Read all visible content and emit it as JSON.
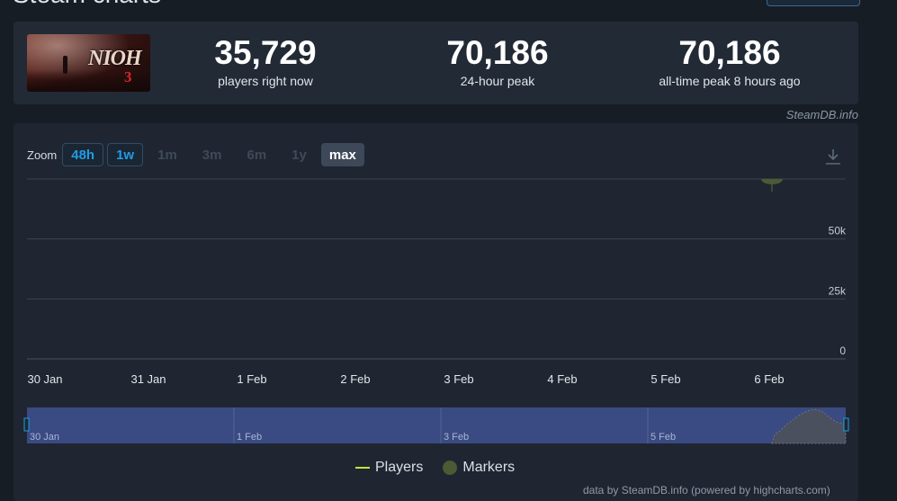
{
  "page": {
    "title": "Steam charts"
  },
  "stats": {
    "game": {
      "logo_text": "NIOH",
      "logo_number": "3"
    },
    "items": [
      {
        "value": "35,729",
        "label": "players right now"
      },
      {
        "value": "70,186",
        "label": "24-hour peak"
      },
      {
        "value": "70,186",
        "label": "all-time peak 8 hours ago"
      }
    ],
    "source": "SteamDB.info"
  },
  "chart": {
    "zoom_label": "Zoom",
    "zoom_options": [
      {
        "label": "48h",
        "state": "available"
      },
      {
        "label": "1w",
        "state": "available"
      },
      {
        "label": "1m",
        "state": "disabled"
      },
      {
        "label": "3m",
        "state": "disabled"
      },
      {
        "label": "6m",
        "state": "disabled"
      },
      {
        "label": "1y",
        "state": "disabled"
      },
      {
        "label": "max",
        "state": "selected"
      }
    ],
    "download_icon": "download-icon",
    "legend": {
      "players": "Players",
      "markers": "Markers"
    },
    "credit": "data by SteamDB.info (powered by highcharts.com)",
    "colors": {
      "players": "#c8e23e",
      "markers": "#4b5b33",
      "navigator": "#3a4a82"
    }
  },
  "chart_data": {
    "type": "line",
    "ylim": [
      0,
      75000
    ],
    "y_ticks": [
      {
        "value": 0,
        "label": "0"
      },
      {
        "value": 25000,
        "label": "25k"
      },
      {
        "value": 50000,
        "label": "50k"
      }
    ],
    "x_ticks": [
      "30 Jan",
      "31 Jan",
      "1 Feb",
      "2 Feb",
      "3 Feb",
      "4 Feb",
      "5 Feb",
      "6 Feb"
    ],
    "navigator_ticks": [
      "30 Jan",
      "1 Feb",
      "3 Feb",
      "5 Feb"
    ],
    "series": [
      {
        "name": "Players",
        "values": []
      },
      {
        "name": "Markers",
        "values": []
      }
    ]
  }
}
